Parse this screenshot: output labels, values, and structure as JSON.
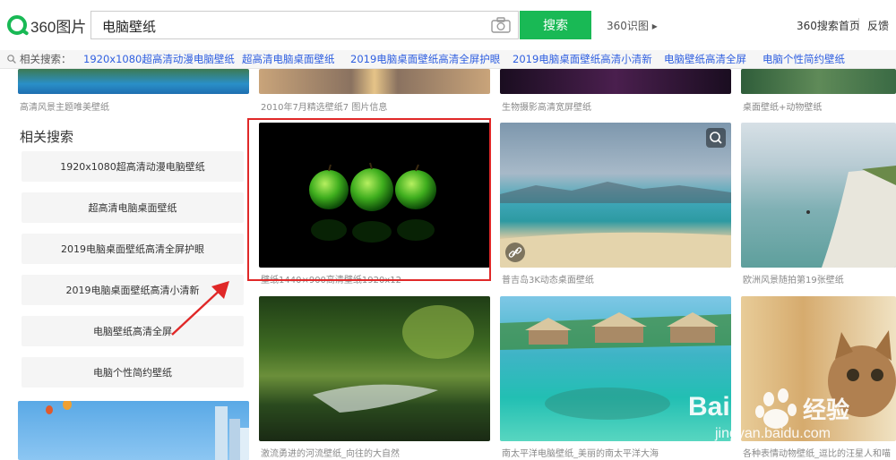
{
  "header": {
    "logo_text": "360图片",
    "search_value": "电脑壁纸",
    "search_button": "搜索",
    "shitu": "360识图 ▸",
    "home_link": "360搜索首页",
    "feedback": "反馈"
  },
  "related_bar": {
    "label": "相关搜索：",
    "links": [
      "1920x1080超高清动漫电脑壁纸",
      "超高清电脑桌面壁纸",
      "2019电脑桌面壁纸高清全屏护眼",
      "2019电脑桌面壁纸高清小清新",
      "电脑壁纸高清全屏",
      "电脑个性简约壁纸"
    ]
  },
  "sidebar": {
    "title": "相关搜索",
    "items": [
      "1920x1080超高清动漫电脑壁纸",
      "超高清电脑桌面壁纸",
      "2019电脑桌面壁纸高清全屏护眼",
      "2019电脑桌面壁纸高清小清新",
      "电脑壁纸高清全屏",
      "电脑个性简约壁纸"
    ]
  },
  "grid": {
    "row0_captions": [
      "高清风景主题唯美壁纸",
      "2010年7月精选壁纸7 图片信息",
      "生物摄影高清宽屏壁纸",
      "桌面壁纸+动物壁纸"
    ],
    "row1_captions": [
      "壁纸1440×900高清壁纸1920x12",
      "普吉岛3K动态桌面壁纸",
      "欧洲风景随拍第19张壁纸"
    ],
    "row2_captions": [
      "激流勇进的河流壁纸_向往的大自然",
      "南太平洋电脑壁纸_美丽的南太平洋大海",
      "各种表情动物壁纸_逗比的汪星人和喵"
    ]
  },
  "watermark": {
    "brand_a": "Bai",
    "brand_b": "经验",
    "url": "jingyan.baidu.com"
  },
  "colors": {
    "accent": "#19b955",
    "link": "#2f5fe0",
    "highlight": "#e02828"
  }
}
